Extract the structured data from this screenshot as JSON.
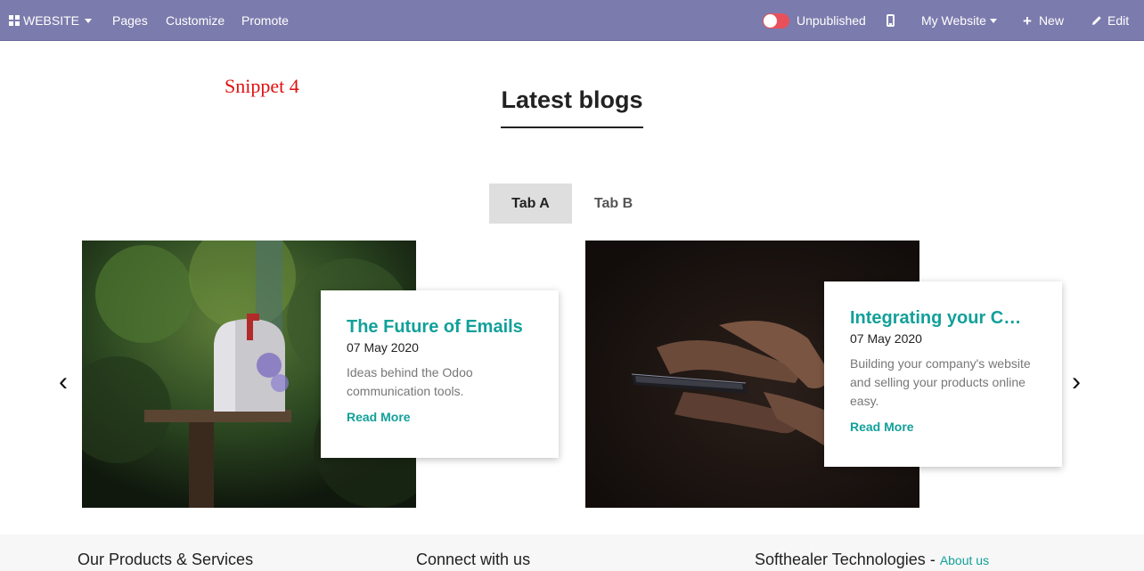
{
  "topbar": {
    "website_label": "WEBSITE",
    "nav": [
      "Pages",
      "Customize",
      "Promote"
    ],
    "publish_status": "Unpublished",
    "site_selector": "My Website",
    "new_label": "New",
    "edit_label": "Edit",
    "icons": [
      "apps-icon",
      "caret-down-icon",
      "toggle-switch",
      "mobile-icon",
      "plus-icon",
      "pencil-icon"
    ],
    "colors": {
      "bar": "#7c7bad",
      "toggle": "#e8505b"
    }
  },
  "snippet_label": "Snippet 4",
  "section": {
    "title": "Latest blogs",
    "tabs": [
      {
        "label": "Tab A",
        "active": true
      },
      {
        "label": "Tab B",
        "active": false
      }
    ]
  },
  "carousel": {
    "prev": "‹",
    "next": "›",
    "posts": [
      {
        "title": "The Future of Emails",
        "date": "07 May 2020",
        "description": "Ideas behind the Odoo communication tools.",
        "read_more": "Read More",
        "image": "mailbox photo"
      },
      {
        "title": "Integrating your C…",
        "date": "07 May 2020",
        "description": "Building your company's website and selling your products online easy.",
        "read_more": "Read More",
        "image": "smartphone in hands photo"
      }
    ],
    "accent": "#12a09a"
  },
  "footer": {
    "col1": "Our Products & Services",
    "col2": "Connect with us",
    "col3": "Softhealer Technologies",
    "col3_sep": " - ",
    "col3_link": "About us"
  }
}
